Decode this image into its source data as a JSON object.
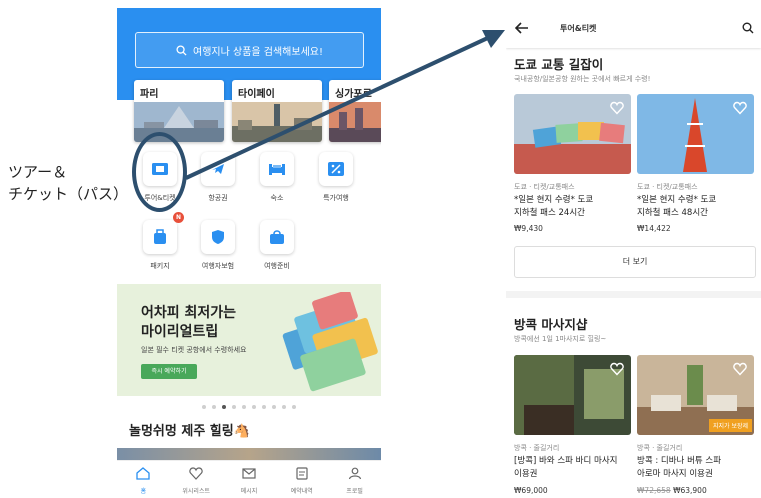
{
  "annotation": {
    "label_line1": "ツアー＆",
    "label_line2": "チケット（パス）"
  },
  "left": {
    "search_placeholder": "여행지나 상품을 검색해보세요!",
    "cities": [
      {
        "name": "파리"
      },
      {
        "name": "타이페이"
      },
      {
        "name": "싱가포르"
      }
    ],
    "categories": [
      {
        "label": "투어&티켓",
        "icon": "ticket-icon"
      },
      {
        "label": "항공권",
        "icon": "airplane-icon"
      },
      {
        "label": "숙소",
        "icon": "bed-icon"
      },
      {
        "label": "특가여행",
        "icon": "discount-icon"
      },
      {
        "label": "패키지",
        "icon": "luggage-icon",
        "badge": "N"
      },
      {
        "label": "여행자보험",
        "icon": "shield-icon"
      },
      {
        "label": "여행준비",
        "icon": "bag-icon"
      }
    ],
    "banner": {
      "title_line1": "어차피 최저가는",
      "title_line2": "마이리얼트립",
      "subtitle": "일본 필수 티켓 공항에서 수령하세요",
      "button": "즉시 예약하기"
    },
    "section_title": "놀멍쉬멍 제주 힐링🐴",
    "nav": [
      {
        "label": "홈",
        "icon": "home-icon",
        "active": true
      },
      {
        "label": "위시리스트",
        "icon": "heart-icon"
      },
      {
        "label": "메시지",
        "icon": "mail-icon"
      },
      {
        "label": "예약내역",
        "icon": "receipt-icon"
      },
      {
        "label": "프로필",
        "icon": "profile-icon"
      }
    ]
  },
  "right": {
    "title": "투어&티켓",
    "section1": {
      "title": "도쿄 교통 길잡이",
      "subtitle": "국내공항/일본공항 원하는 곳에서 빠르게 수령!",
      "products": [
        {
          "category": "도쿄 · 티켓/교통패스",
          "name_line1": "*일본 현지 수령* 도쿄",
          "name_line2": "지하철 패스 24시간",
          "price": "₩9,430"
        },
        {
          "category": "도쿄 · 티켓/교통패스",
          "name_line1": "*일본 현지 수령* 도쿄",
          "name_line2": "지하철 패스 48시간",
          "price": "₩14,422"
        }
      ],
      "more": "더 보기"
    },
    "section2": {
      "title": "방콕 마사지샵",
      "subtitle": "방콕에선 1일 1마사지로 힐링~",
      "products": [
        {
          "category": "방콕 · 줄길거리",
          "name_line1": "[방콕] 바와 스파 바디 마사지",
          "name_line2": "이용권",
          "price": "₩69,000"
        },
        {
          "category": "방콕 · 줄길거리",
          "name_line1": "방콕 : 디바나 버튜 스파",
          "name_line2": "아로마 마사지 이용권",
          "old_price": "₩72,658",
          "price": "₩63,900",
          "tag": "지지가 보장제"
        }
      ]
    }
  }
}
